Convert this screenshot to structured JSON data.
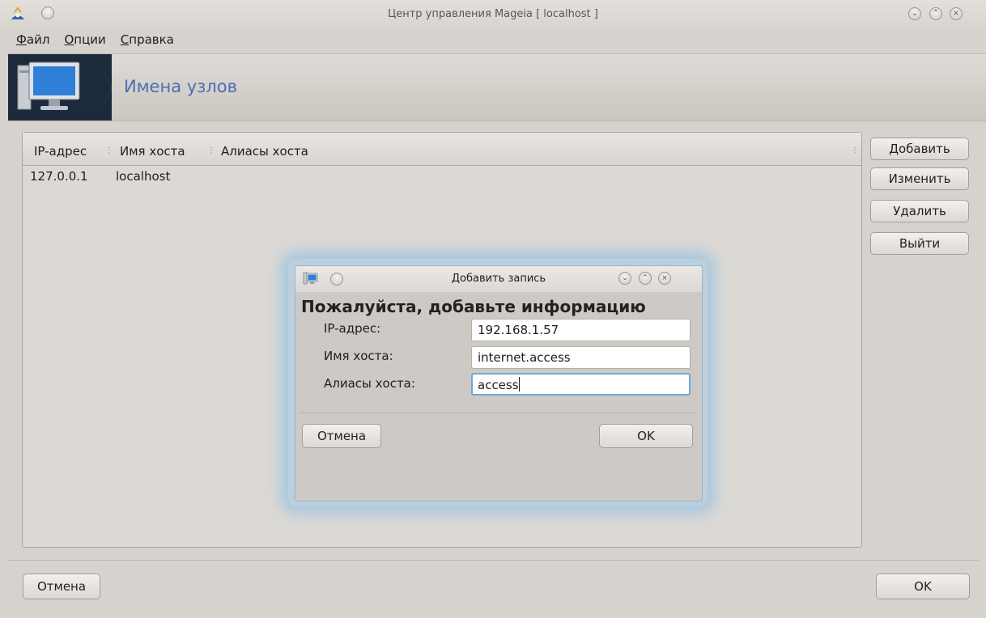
{
  "window": {
    "title": "Центр управления Mageia  [ localhost ]"
  },
  "menubar": {
    "items": [
      {
        "accel": "Ф",
        "rest": "айл"
      },
      {
        "accel": "О",
        "rest": "пции"
      },
      {
        "accel": "С",
        "rest": "правка"
      }
    ]
  },
  "banner": {
    "title": "Имена узлов",
    "icon": "computer-monitor-icon"
  },
  "table": {
    "columns": [
      "IP-адрес",
      "Имя хоста",
      "Алиасы хоста"
    ],
    "rows": [
      {
        "ip": "127.0.0.1",
        "hostname": "localhost",
        "aliases": ""
      }
    ]
  },
  "side_buttons": {
    "add": "Добавить",
    "edit": "Изменить",
    "delete": "Удалить",
    "quit": "Выйти"
  },
  "footer": {
    "cancel": "Отмена",
    "ok": "OK"
  },
  "dialog": {
    "title": "Добавить запись",
    "heading": "Пожалуйста, добавьте информацию",
    "fields": {
      "ip": {
        "label": "IP-адрес:",
        "value": "192.168.1.57"
      },
      "hostname": {
        "label": "Имя хоста:",
        "value": "internet.access"
      },
      "aliases": {
        "label": "Алиасы хоста:",
        "value": "access"
      }
    },
    "cancel": "Отмена",
    "ok": "OK"
  },
  "colors": {
    "accent_blue": "#4a70b4",
    "focus_ring": "#6fa8dc",
    "background": "#d6d2cd"
  }
}
